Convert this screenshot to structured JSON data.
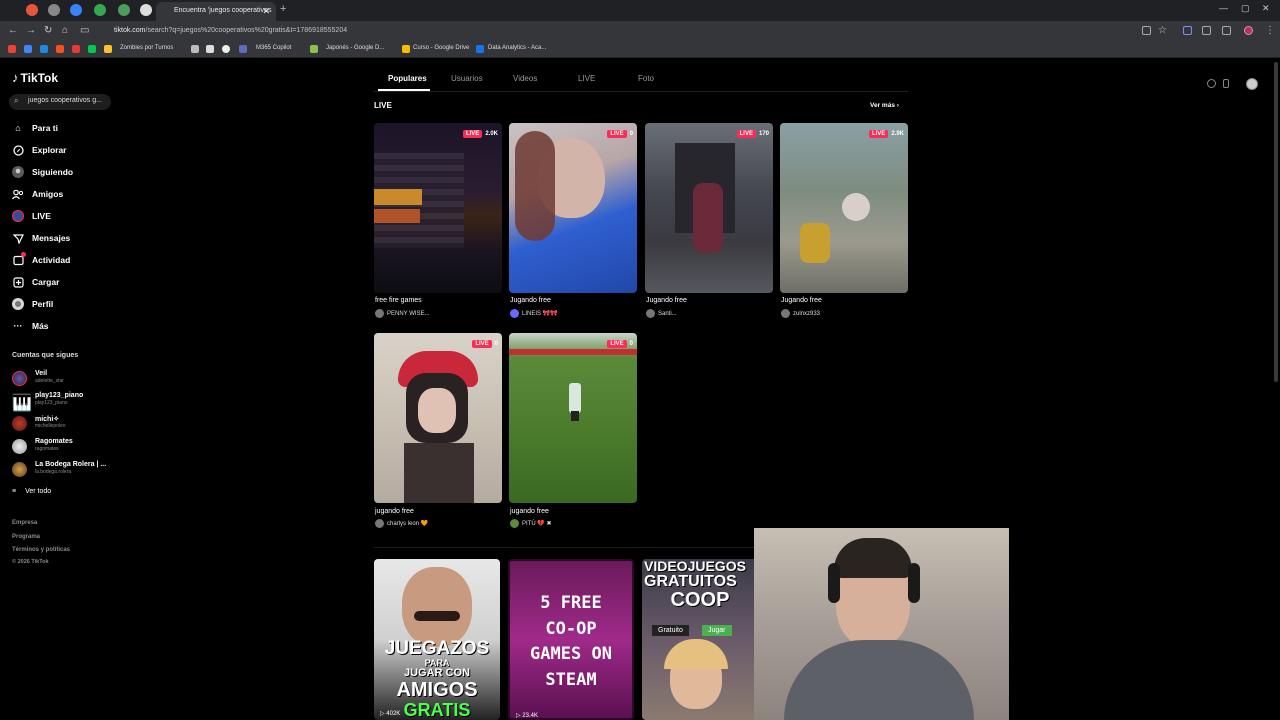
{
  "browser": {
    "active_tab_title": "Encuentra 'juegos cooperativos",
    "url_host": "tiktok.com",
    "url_path": "/search?q=juegos%20cooperativos%20gratis&t=1786918555204",
    "bookmarks": [
      "Zombies por Turnos",
      "M365 Copilot",
      "Japonés - Google D...",
      "Curso - Google Drive",
      "Data Analytics - Aca..."
    ]
  },
  "sidebar": {
    "logo": "TikTok",
    "search_value": "juegos cooperativos g...",
    "nav": [
      {
        "label": "Para ti",
        "icon": "home-icon"
      },
      {
        "label": "Explorar",
        "icon": "compass-icon"
      },
      {
        "label": "Siguiendo",
        "icon": "following-icon"
      },
      {
        "label": "Amigos",
        "icon": "friends-icon"
      },
      {
        "label": "LIVE",
        "icon": "live-icon"
      },
      {
        "label": "Mensajes",
        "icon": "messages-icon"
      },
      {
        "label": "Actividad",
        "icon": "activity-icon"
      },
      {
        "label": "Cargar",
        "icon": "upload-icon"
      },
      {
        "label": "Perfil",
        "icon": "profile-icon"
      },
      {
        "label": "Más",
        "icon": "more-icon"
      }
    ],
    "following_title": "Cuentas que sigues",
    "accounts": [
      {
        "name": "Veil",
        "handle": "adelette_star"
      },
      {
        "name": "play123_piano",
        "handle": "play123_piano"
      },
      {
        "name": "michi✧",
        "handle": "michellepoleo"
      },
      {
        "name": "Ragomates",
        "handle": "ragomates"
      },
      {
        "name": "La Bodega Rolera | ...",
        "handle": "la.bodega.rolera"
      }
    ],
    "see_all": "Ver todo",
    "footer": [
      "Empresa",
      "Programa",
      "Términos y políticas",
      "© 2026 TikTok"
    ]
  },
  "main": {
    "tabs": [
      "Populares",
      "Usuarios",
      "Videos",
      "LIVE",
      "Foto"
    ],
    "section_title": "LIVE",
    "see_more": "Ver más",
    "live_cards": [
      {
        "badge": "LIVE",
        "viewers": "2.0K",
        "title": "free fire games",
        "user": "PENNY WISE..."
      },
      {
        "badge": "LIVE",
        "viewers": "0",
        "title": "Jugando free",
        "user": "LINEIS 🎀🎀"
      },
      {
        "badge": "LIVE",
        "viewers": "170",
        "title": "Jugando free",
        "user": "Santi..."
      },
      {
        "badge": "LIVE",
        "viewers": "2.9K",
        "title": "Jugando free",
        "user": "zulnxz933"
      },
      {
        "badge": "LIVE",
        "viewers": "0",
        "title": "jugando free",
        "user": "charlys leon 🧡"
      },
      {
        "badge": "LIVE",
        "viewers": "0",
        "title": "jugando free",
        "user": "PITÚ 💔 ✖"
      }
    ],
    "videos": [
      {
        "lines": [
          "JUEGAZOS",
          "PARA",
          "JUGAR CON",
          "AMIGOS",
          "GRATIS"
        ],
        "views": "402K"
      },
      {
        "lines": [
          "5 FREE",
          "CO-OP",
          "GAMES ON",
          "STEAM"
        ],
        "views": "23.4K"
      },
      {
        "lines": [
          "VIDEOJUEGOS",
          "GRATUITOS",
          "COOP"
        ],
        "tag1": "Gratuito",
        "tag2": "Jugar"
      }
    ]
  }
}
